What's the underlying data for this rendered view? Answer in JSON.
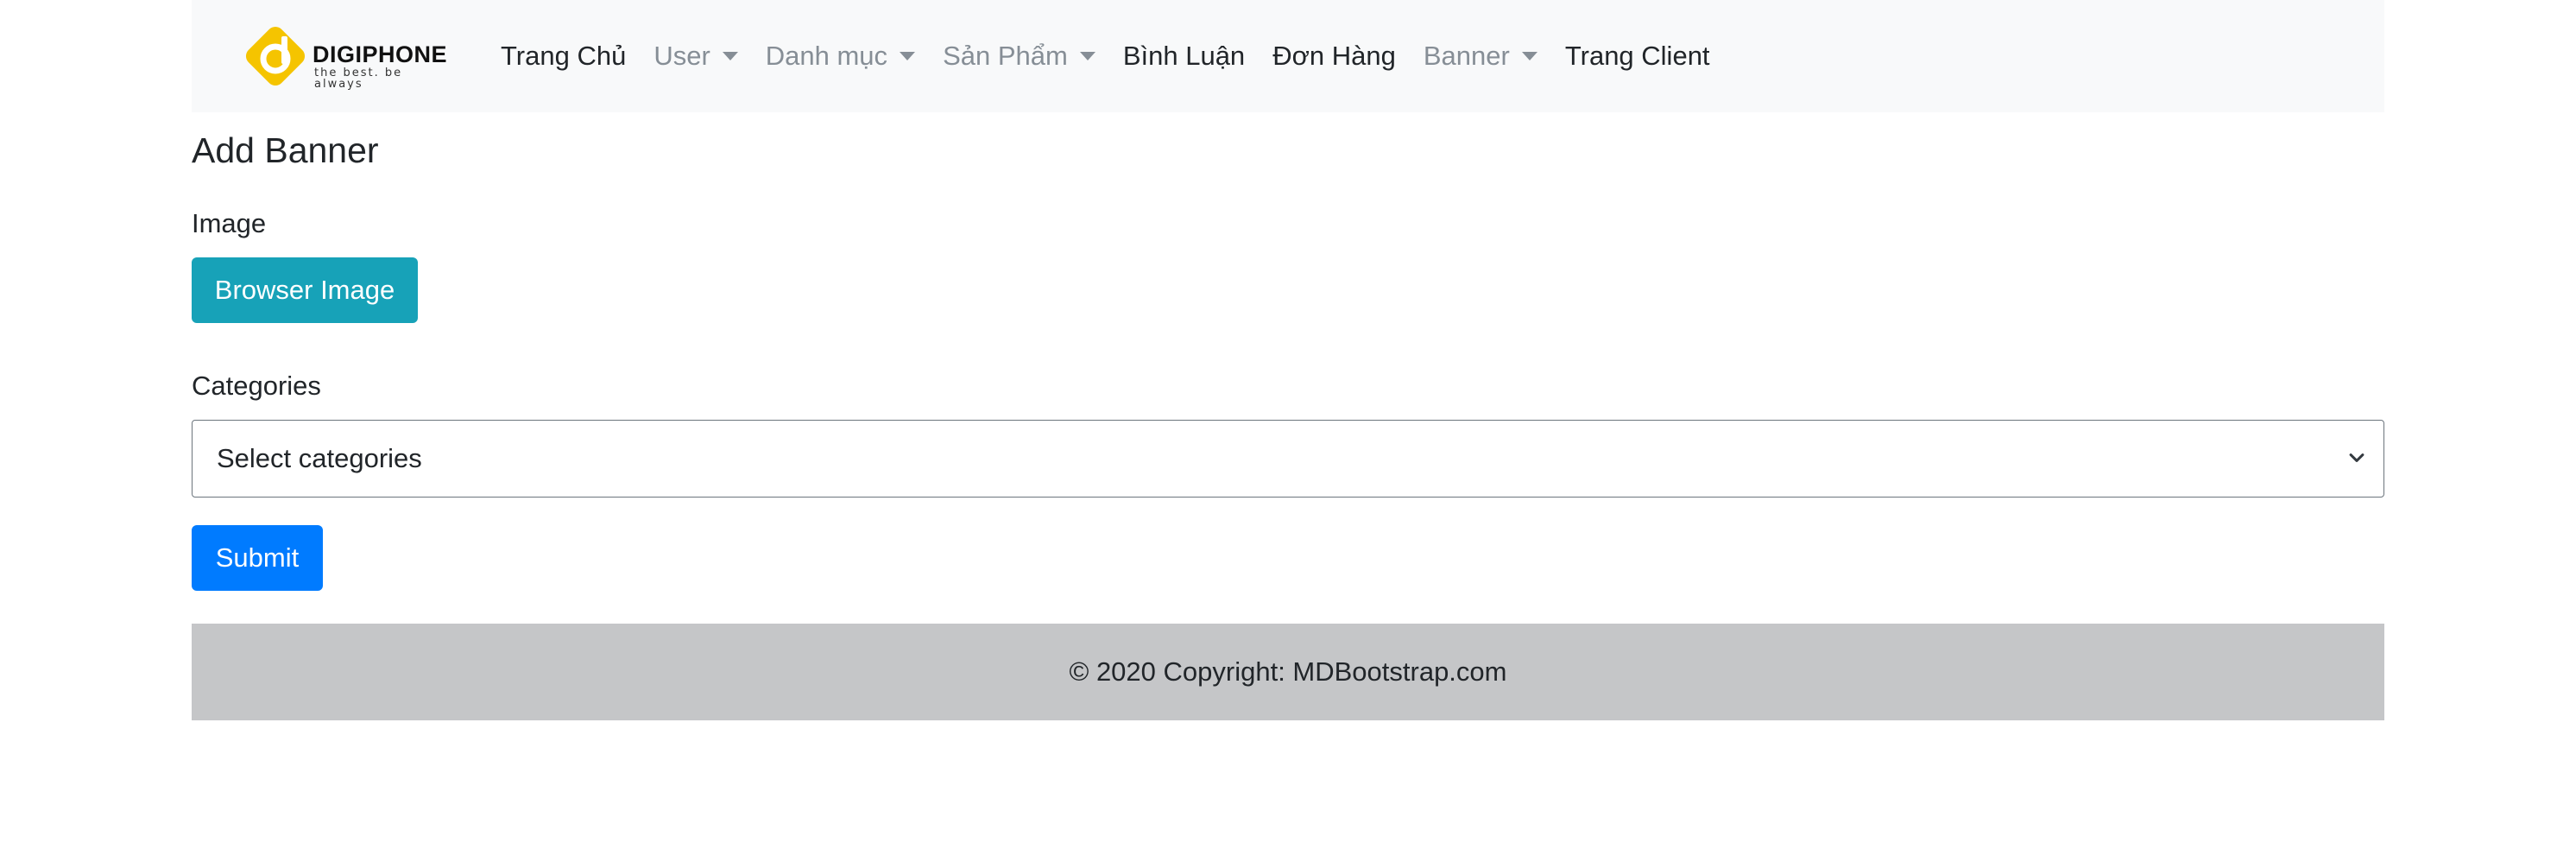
{
  "navbar": {
    "brand": {
      "name": "DIGIPHONE",
      "tagline": "the best. be always",
      "logo_icon": "digiphone-logo-icon"
    },
    "items": [
      {
        "label": "Trang Chủ",
        "dropdown": false
      },
      {
        "label": "User",
        "dropdown": true
      },
      {
        "label": "Danh mục",
        "dropdown": true
      },
      {
        "label": "Sản Phẩm",
        "dropdown": true
      },
      {
        "label": "Bình Luận",
        "dropdown": false
      },
      {
        "label": "Đơn Hàng",
        "dropdown": false
      },
      {
        "label": "Banner",
        "dropdown": true
      },
      {
        "label": "Trang Client",
        "dropdown": false
      }
    ]
  },
  "form": {
    "title": "Add Banner",
    "image_label": "Image",
    "browse_button": "Browser Image",
    "categories_label": "Categories",
    "categories_select": {
      "selected": "Select categories"
    },
    "submit_button": "Submit"
  },
  "footer": {
    "text": "© 2020 Copyright: MDBootstrap.com"
  },
  "colors": {
    "navbar_bg": "#f8f9fa",
    "info_button": "#17a2b8",
    "primary_button": "#007bff",
    "footer_bg": "#c5c6c8",
    "logo_yellow": "#f5c400"
  }
}
